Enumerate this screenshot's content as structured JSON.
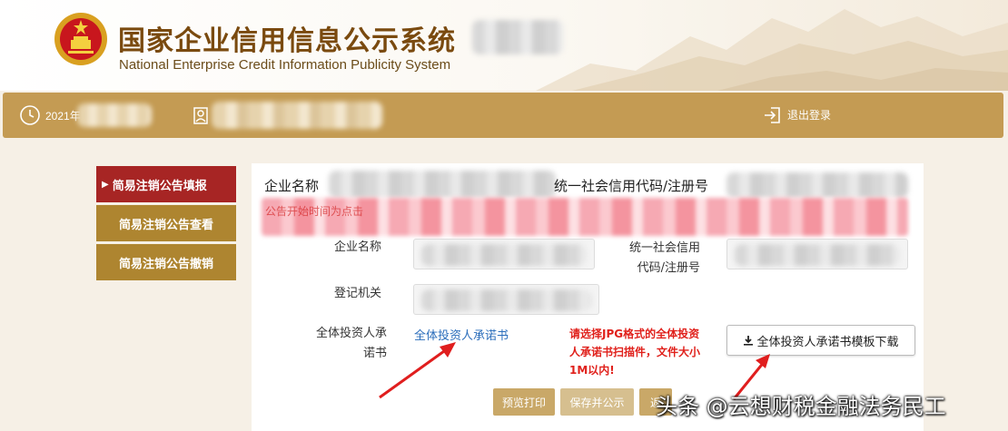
{
  "header": {
    "title_cn": "国家企业信用信息公示系统",
    "title_en": "National Enterprise Credit Information Publicity System"
  },
  "toolbar": {
    "date_prefix": "2021年",
    "logout_label": "退出登录"
  },
  "sidebar": {
    "items": [
      {
        "label": "简易注销公告填报",
        "active": true
      },
      {
        "label": "简易注销公告查看",
        "active": false
      },
      {
        "label": "简易注销公告撤销",
        "active": false
      }
    ]
  },
  "main": {
    "company_name_label": "企业名称",
    "credit_code_label": "统一社会信用代码/注册号",
    "notice_text": "公告开始时间为点击",
    "form": {
      "company_name_label": "企业名称",
      "credit_code_label_line1": "统一社会信用",
      "credit_code_label_line2": "代码/注册号",
      "registration_authority_label": "登记机关",
      "investor_commitment_label_line1": "全体投资人承",
      "investor_commitment_label_line2": "诺书",
      "investor_commitment_link": "全体投资人承诺书",
      "upload_hint": "请选择JPG格式的全体投资人承诺书扫描件，文件大小1M以内!",
      "download_template_button": "全体投资人承诺书模板下载"
    },
    "buttons": {
      "preview_print": "预览打印",
      "save_publish": "保存并公示",
      "back": "返"
    }
  },
  "watermark": "头条 @云想财税金融法务民工",
  "colors": {
    "toolbar_bg": "#c49b53",
    "sidebar_bg": "#ae8530",
    "sidebar_active_bg": "#a72524",
    "warning_red": "#e0201b",
    "link_blue": "#2a6dbb",
    "title_brown": "#7a4a0f"
  },
  "icons": [
    "national-emblem-icon",
    "clock-icon",
    "user-badge-icon",
    "logout-icon",
    "download-icon",
    "arrow-annotation-icon"
  ]
}
